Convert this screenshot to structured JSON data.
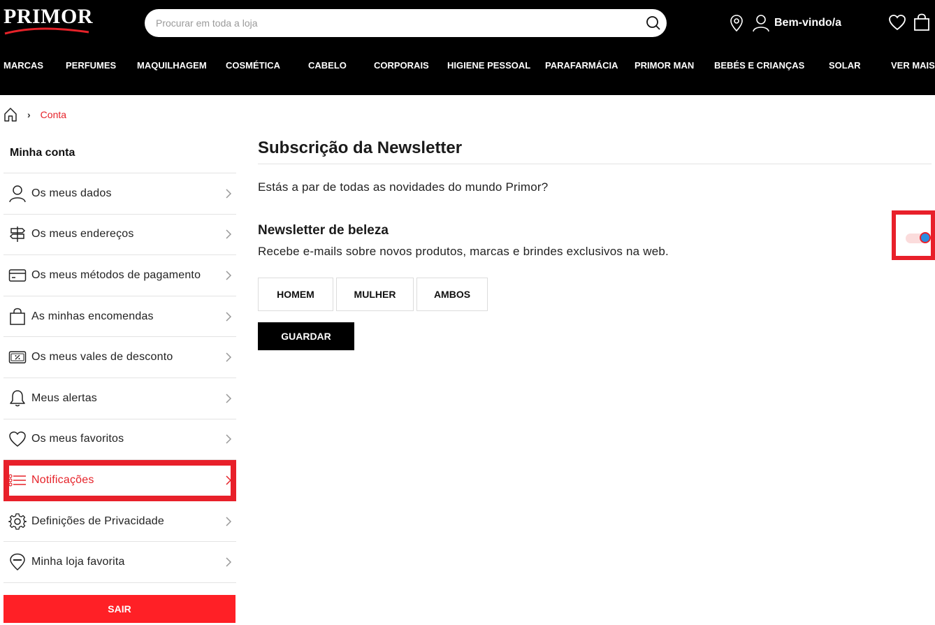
{
  "header": {
    "logo": "PRIMOR",
    "search_placeholder": "Procurar em toda a loja",
    "user_label": "Bem-vindo/a",
    "icons": [
      "location-icon",
      "user-icon",
      "heart-icon",
      "bag-icon",
      "search-icon"
    ]
  },
  "nav": {
    "items": [
      "MARCAS",
      "PERFUMES",
      "MAQUILHAGEM",
      "COSMÉTICA",
      "CABELO",
      "CORPORAIS",
      "HIGIENE PESSOAL",
      "PARAFARMÁCIA",
      "PRIMOR MAN",
      "BEBÉS E CRIANÇAS",
      "SOLAR",
      "VER MAIS"
    ]
  },
  "breadcrumb": {
    "current": "Conta"
  },
  "sidebar": {
    "title": "Minha conta",
    "items": [
      {
        "label": "Os meus dados",
        "icon": "user-icon"
      },
      {
        "label": "Os meus endereços",
        "icon": "signpost-icon"
      },
      {
        "label": "Os meus métodos de pagamento",
        "icon": "credit-card-icon"
      },
      {
        "label": "As minhas encomendas",
        "icon": "shopping-bag-icon"
      },
      {
        "label": "Os meus vales de desconto",
        "icon": "voucher-icon"
      },
      {
        "label": "Meus alertas",
        "icon": "bell-icon"
      },
      {
        "label": "Os meus favoritos",
        "icon": "heart-icon"
      },
      {
        "label": "Notificações",
        "icon": "list-icon",
        "active": true
      },
      {
        "label": "Definições de Privacidade",
        "icon": "gear-icon"
      },
      {
        "label": "Minha loja favorita",
        "icon": "store-pin-icon"
      }
    ],
    "logout_label": "SAIR"
  },
  "main": {
    "title": "Subscrição da Newsletter",
    "intro": "Estás a par de todas as novidades do mundo Primor?",
    "newsletter_title": "Newsletter de beleza",
    "newsletter_desc": "Recebe e-mails sobre novos produtos, marcas e brindes exclusivos na web.",
    "toggle_on": true,
    "gender_options": [
      "HOMEM",
      "MULHER",
      "AMBOS"
    ],
    "save_label": "GUARDAR"
  },
  "colors": {
    "accent": "#e62229",
    "header_bg": "#000000",
    "logout_bg": "#ff2026"
  }
}
